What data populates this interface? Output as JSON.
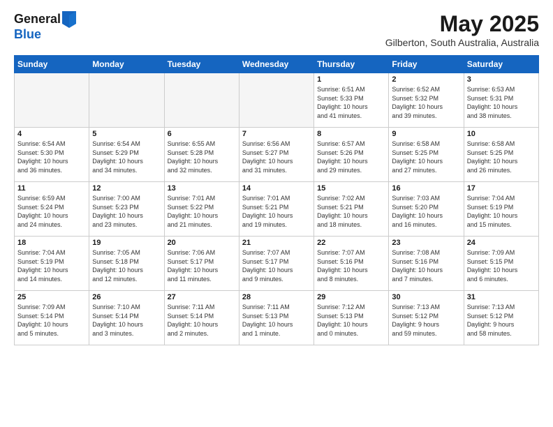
{
  "header": {
    "logo_general": "General",
    "logo_blue": "Blue",
    "month_title": "May 2025",
    "location": "Gilberton, South Australia, Australia"
  },
  "weekdays": [
    "Sunday",
    "Monday",
    "Tuesday",
    "Wednesday",
    "Thursday",
    "Friday",
    "Saturday"
  ],
  "weeks": [
    [
      {
        "day": "",
        "info": "",
        "empty": true
      },
      {
        "day": "",
        "info": "",
        "empty": true
      },
      {
        "day": "",
        "info": "",
        "empty": true
      },
      {
        "day": "",
        "info": "",
        "empty": true
      },
      {
        "day": "1",
        "info": "Sunrise: 6:51 AM\nSunset: 5:33 PM\nDaylight: 10 hours\nand 41 minutes."
      },
      {
        "day": "2",
        "info": "Sunrise: 6:52 AM\nSunset: 5:32 PM\nDaylight: 10 hours\nand 39 minutes."
      },
      {
        "day": "3",
        "info": "Sunrise: 6:53 AM\nSunset: 5:31 PM\nDaylight: 10 hours\nand 38 minutes."
      }
    ],
    [
      {
        "day": "4",
        "info": "Sunrise: 6:54 AM\nSunset: 5:30 PM\nDaylight: 10 hours\nand 36 minutes."
      },
      {
        "day": "5",
        "info": "Sunrise: 6:54 AM\nSunset: 5:29 PM\nDaylight: 10 hours\nand 34 minutes."
      },
      {
        "day": "6",
        "info": "Sunrise: 6:55 AM\nSunset: 5:28 PM\nDaylight: 10 hours\nand 32 minutes."
      },
      {
        "day": "7",
        "info": "Sunrise: 6:56 AM\nSunset: 5:27 PM\nDaylight: 10 hours\nand 31 minutes."
      },
      {
        "day": "8",
        "info": "Sunrise: 6:57 AM\nSunset: 5:26 PM\nDaylight: 10 hours\nand 29 minutes."
      },
      {
        "day": "9",
        "info": "Sunrise: 6:58 AM\nSunset: 5:25 PM\nDaylight: 10 hours\nand 27 minutes."
      },
      {
        "day": "10",
        "info": "Sunrise: 6:58 AM\nSunset: 5:25 PM\nDaylight: 10 hours\nand 26 minutes."
      }
    ],
    [
      {
        "day": "11",
        "info": "Sunrise: 6:59 AM\nSunset: 5:24 PM\nDaylight: 10 hours\nand 24 minutes."
      },
      {
        "day": "12",
        "info": "Sunrise: 7:00 AM\nSunset: 5:23 PM\nDaylight: 10 hours\nand 23 minutes."
      },
      {
        "day": "13",
        "info": "Sunrise: 7:01 AM\nSunset: 5:22 PM\nDaylight: 10 hours\nand 21 minutes."
      },
      {
        "day": "14",
        "info": "Sunrise: 7:01 AM\nSunset: 5:21 PM\nDaylight: 10 hours\nand 19 minutes."
      },
      {
        "day": "15",
        "info": "Sunrise: 7:02 AM\nSunset: 5:21 PM\nDaylight: 10 hours\nand 18 minutes."
      },
      {
        "day": "16",
        "info": "Sunrise: 7:03 AM\nSunset: 5:20 PM\nDaylight: 10 hours\nand 16 minutes."
      },
      {
        "day": "17",
        "info": "Sunrise: 7:04 AM\nSunset: 5:19 PM\nDaylight: 10 hours\nand 15 minutes."
      }
    ],
    [
      {
        "day": "18",
        "info": "Sunrise: 7:04 AM\nSunset: 5:19 PM\nDaylight: 10 hours\nand 14 minutes."
      },
      {
        "day": "19",
        "info": "Sunrise: 7:05 AM\nSunset: 5:18 PM\nDaylight: 10 hours\nand 12 minutes."
      },
      {
        "day": "20",
        "info": "Sunrise: 7:06 AM\nSunset: 5:17 PM\nDaylight: 10 hours\nand 11 minutes."
      },
      {
        "day": "21",
        "info": "Sunrise: 7:07 AM\nSunset: 5:17 PM\nDaylight: 10 hours\nand 9 minutes."
      },
      {
        "day": "22",
        "info": "Sunrise: 7:07 AM\nSunset: 5:16 PM\nDaylight: 10 hours\nand 8 minutes."
      },
      {
        "day": "23",
        "info": "Sunrise: 7:08 AM\nSunset: 5:16 PM\nDaylight: 10 hours\nand 7 minutes."
      },
      {
        "day": "24",
        "info": "Sunrise: 7:09 AM\nSunset: 5:15 PM\nDaylight: 10 hours\nand 6 minutes."
      }
    ],
    [
      {
        "day": "25",
        "info": "Sunrise: 7:09 AM\nSunset: 5:14 PM\nDaylight: 10 hours\nand 5 minutes."
      },
      {
        "day": "26",
        "info": "Sunrise: 7:10 AM\nSunset: 5:14 PM\nDaylight: 10 hours\nand 3 minutes."
      },
      {
        "day": "27",
        "info": "Sunrise: 7:11 AM\nSunset: 5:14 PM\nDaylight: 10 hours\nand 2 minutes."
      },
      {
        "day": "28",
        "info": "Sunrise: 7:11 AM\nSunset: 5:13 PM\nDaylight: 10 hours\nand 1 minute."
      },
      {
        "day": "29",
        "info": "Sunrise: 7:12 AM\nSunset: 5:13 PM\nDaylight: 10 hours\nand 0 minutes."
      },
      {
        "day": "30",
        "info": "Sunrise: 7:13 AM\nSunset: 5:12 PM\nDaylight: 9 hours\nand 59 minutes."
      },
      {
        "day": "31",
        "info": "Sunrise: 7:13 AM\nSunset: 5:12 PM\nDaylight: 9 hours\nand 58 minutes."
      }
    ]
  ]
}
